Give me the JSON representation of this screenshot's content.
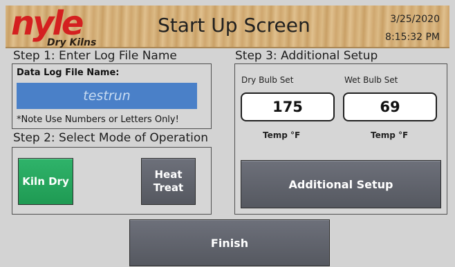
{
  "header": {
    "logo": "nyle",
    "logo_sub": "Dry Kilns",
    "title": "Start Up Screen",
    "date": "3/25/2020",
    "time": "8:15:32 PM"
  },
  "step1": {
    "label": "Step 1:  Enter Log File Name",
    "field_label": "Data Log File Name:",
    "value": "testrun",
    "note": "*Note Use Numbers or Letters Only!"
  },
  "step2": {
    "label": "Step 2:  Select Mode of Operation",
    "kiln_dry": "Kiln Dry",
    "heat_treat_line1": "Heat",
    "heat_treat_line2": "Treat"
  },
  "step3": {
    "label": "Step 3:  Additional Setup",
    "dry_bulb_label": "Dry Bulb Set",
    "wet_bulb_label": "Wet Bulb Set",
    "dry_bulb_value": "175",
    "wet_bulb_value": "69",
    "dry_unit": "Temp °F",
    "wet_unit": "Temp °F",
    "additional_setup": "Additional Setup"
  },
  "finish": "Finish",
  "colors": {
    "accent_green": "#2fb36a",
    "input_blue": "#4a80c8",
    "logo_red": "#d42020",
    "button_grey": "#5f626b"
  }
}
